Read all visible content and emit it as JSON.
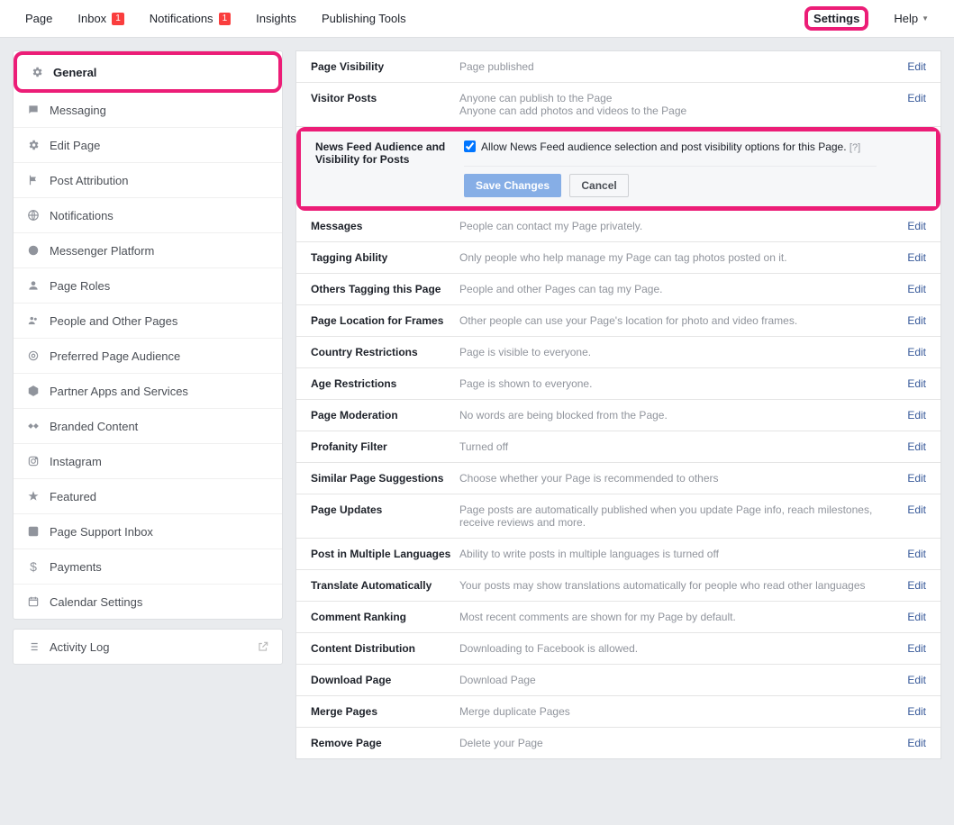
{
  "topnav": {
    "page": "Page",
    "inbox": "Inbox",
    "inbox_badge": "1",
    "notifications": "Notifications",
    "notifications_badge": "1",
    "insights": "Insights",
    "publishing": "Publishing Tools",
    "settings": "Settings",
    "help": "Help"
  },
  "sidebar": {
    "items": [
      {
        "label": "General",
        "icon": "gear-icon"
      },
      {
        "label": "Messaging",
        "icon": "chat-icon"
      },
      {
        "label": "Edit Page",
        "icon": "gear-icon"
      },
      {
        "label": "Post Attribution",
        "icon": "flag-icon"
      },
      {
        "label": "Notifications",
        "icon": "globe-icon"
      },
      {
        "label": "Messenger Platform",
        "icon": "messenger-icon"
      },
      {
        "label": "Page Roles",
        "icon": "person-icon"
      },
      {
        "label": "People and Other Pages",
        "icon": "people-icon"
      },
      {
        "label": "Preferred Page Audience",
        "icon": "target-icon"
      },
      {
        "label": "Partner Apps and Services",
        "icon": "cube-icon"
      },
      {
        "label": "Branded Content",
        "icon": "handshake-icon"
      },
      {
        "label": "Instagram",
        "icon": "instagram-icon"
      },
      {
        "label": "Featured",
        "icon": "star-icon"
      },
      {
        "label": "Page Support Inbox",
        "icon": "fb-icon"
      },
      {
        "label": "Payments",
        "icon": "dollar-icon"
      },
      {
        "label": "Calendar Settings",
        "icon": "calendar-icon"
      }
    ],
    "activity_log": "Activity Log"
  },
  "rows": {
    "page_visibility": {
      "title": "Page Visibility",
      "value": "Page published",
      "edit": "Edit"
    },
    "visitor_posts": {
      "title": "Visitor Posts",
      "line1": "Anyone can publish to the Page",
      "line2": "Anyone can add photos and videos to the Page",
      "edit": "Edit"
    },
    "news_feed": {
      "title": "News Feed Audience and Visibility for Posts",
      "checkbox_label": "Allow News Feed audience selection and post visibility options for this Page.",
      "help": "[?]",
      "save": "Save Changes",
      "cancel": "Cancel"
    },
    "messages": {
      "title": "Messages",
      "value": "People can contact my Page privately.",
      "edit": "Edit"
    },
    "tagging": {
      "title": "Tagging Ability",
      "value": "Only people who help manage my Page can tag photos posted on it.",
      "edit": "Edit"
    },
    "others_tagging": {
      "title": "Others Tagging this Page",
      "value": "People and other Pages can tag my Page.",
      "edit": "Edit"
    },
    "location_frames": {
      "title": "Page Location for Frames",
      "value": "Other people can use your Page's location for photo and video frames.",
      "edit": "Edit"
    },
    "country": {
      "title": "Country Restrictions",
      "value": "Page is visible to everyone.",
      "edit": "Edit"
    },
    "age": {
      "title": "Age Restrictions",
      "value": "Page is shown to everyone.",
      "edit": "Edit"
    },
    "moderation": {
      "title": "Page Moderation",
      "value": "No words are being blocked from the Page.",
      "edit": "Edit"
    },
    "profanity": {
      "title": "Profanity Filter",
      "value": "Turned off",
      "edit": "Edit"
    },
    "similar": {
      "title": "Similar Page Suggestions",
      "value": "Choose whether your Page is recommended to others",
      "edit": "Edit"
    },
    "updates": {
      "title": "Page Updates",
      "value": "Page posts are automatically published when you update Page info, reach milestones, receive reviews and more.",
      "edit": "Edit"
    },
    "multilang": {
      "title": "Post in Multiple Languages",
      "value": "Ability to write posts in multiple languages is turned off",
      "edit": "Edit"
    },
    "translate": {
      "title": "Translate Automatically",
      "value": "Your posts may show translations automatically for people who read other languages",
      "edit": "Edit"
    },
    "comment_rank": {
      "title": "Comment Ranking",
      "value": "Most recent comments are shown for my Page by default.",
      "edit": "Edit"
    },
    "content_dist": {
      "title": "Content Distribution",
      "value": "Downloading to Facebook is allowed.",
      "edit": "Edit"
    },
    "download": {
      "title": "Download Page",
      "value": "Download Page",
      "edit": "Edit"
    },
    "merge": {
      "title": "Merge Pages",
      "value": "Merge duplicate Pages",
      "edit": "Edit"
    },
    "remove": {
      "title": "Remove Page",
      "value": "Delete your Page",
      "edit": "Edit"
    }
  }
}
